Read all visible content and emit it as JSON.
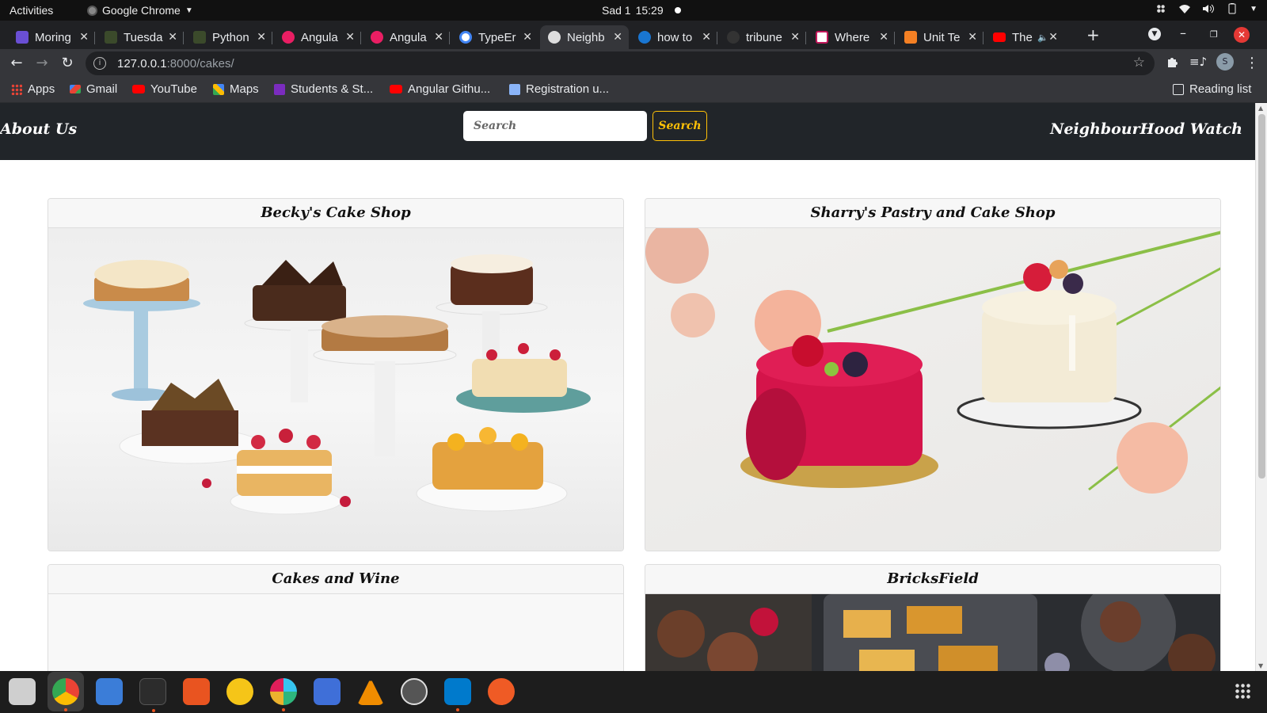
{
  "system_bar": {
    "activities": "Activities",
    "app_name": "Google Chrome",
    "clock_day": "Sad 1",
    "clock_time": "15:29"
  },
  "tabs": [
    {
      "label": "Moring",
      "favicon_color": "#6a4fd4"
    },
    {
      "label": "Tuesda",
      "favicon_color": "#3b4a2b"
    },
    {
      "label": "Python",
      "favicon_color": "#3b4a2b"
    },
    {
      "label": "Angula",
      "favicon_color": "#e91e63"
    },
    {
      "label": "Angula",
      "favicon_color": "#e91e63"
    },
    {
      "label": "TypeEr",
      "favicon_color": "#4285f4"
    },
    {
      "label": "Neighb",
      "favicon_color": "#9aa0a6"
    },
    {
      "label": "how to",
      "favicon_color": "#1976d2"
    },
    {
      "label": "tribune",
      "favicon_color": "#333333"
    },
    {
      "label": "Where",
      "favicon_color": "#ffffff"
    },
    {
      "label": "Unit Te",
      "favicon_color": "#f48024"
    },
    {
      "label": "The",
      "favicon_color": "#ff0000"
    }
  ],
  "address_bar": {
    "host": "127.0.0.1",
    "path": ":8000/cakes/"
  },
  "bookmarks": [
    {
      "label": "Apps",
      "icon": "apps-grid-icon"
    },
    {
      "label": "Gmail",
      "icon": "gmail-icon"
    },
    {
      "label": "YouTube",
      "icon": "youtube-icon"
    },
    {
      "label": "Maps",
      "icon": "maps-icon"
    },
    {
      "label": "Students & St...",
      "icon": "list-icon"
    },
    {
      "label": "Angular Githu...",
      "icon": "youtube-icon"
    },
    {
      "label": "Registration u...",
      "icon": "document-icon"
    }
  ],
  "reading_list": "Reading list",
  "site": {
    "brand_left": "About Us",
    "brand_right": "NeighbourHood Watch",
    "search_placeholder": "Search",
    "search_button": "Search",
    "accent_color": "#ffc107",
    "navbar_color": "#212529"
  },
  "cards": [
    {
      "title": "Becky's Cake Shop",
      "image": "assorted cakes on stands"
    },
    {
      "title": "Sharry's Pastry and Cake Shop",
      "image": "pink and cream mousse cakes"
    },
    {
      "title": "Cakes and Wine",
      "image": ""
    },
    {
      "title": "BricksField",
      "image": "dark tray of pastries"
    }
  ],
  "dock_apps": [
    {
      "name": "files",
      "color": "#c9c9c9"
    },
    {
      "name": "chrome",
      "color": "#4285f4"
    },
    {
      "name": "text-editor",
      "color": "#3b7dd8"
    },
    {
      "name": "terminal",
      "color": "#2c2c2c"
    },
    {
      "name": "software-center",
      "color": "#e95420"
    },
    {
      "name": "rhythmbox",
      "color": "#f5c518"
    },
    {
      "name": "slack",
      "color": "#4a154b"
    },
    {
      "name": "screenshot",
      "color": "#3f6fd8"
    },
    {
      "name": "vlc",
      "color": "#f08c00"
    },
    {
      "name": "updater",
      "color": "#555555"
    },
    {
      "name": "vscode",
      "color": "#007acc"
    },
    {
      "name": "postman",
      "color": "#ef5b25"
    }
  ]
}
